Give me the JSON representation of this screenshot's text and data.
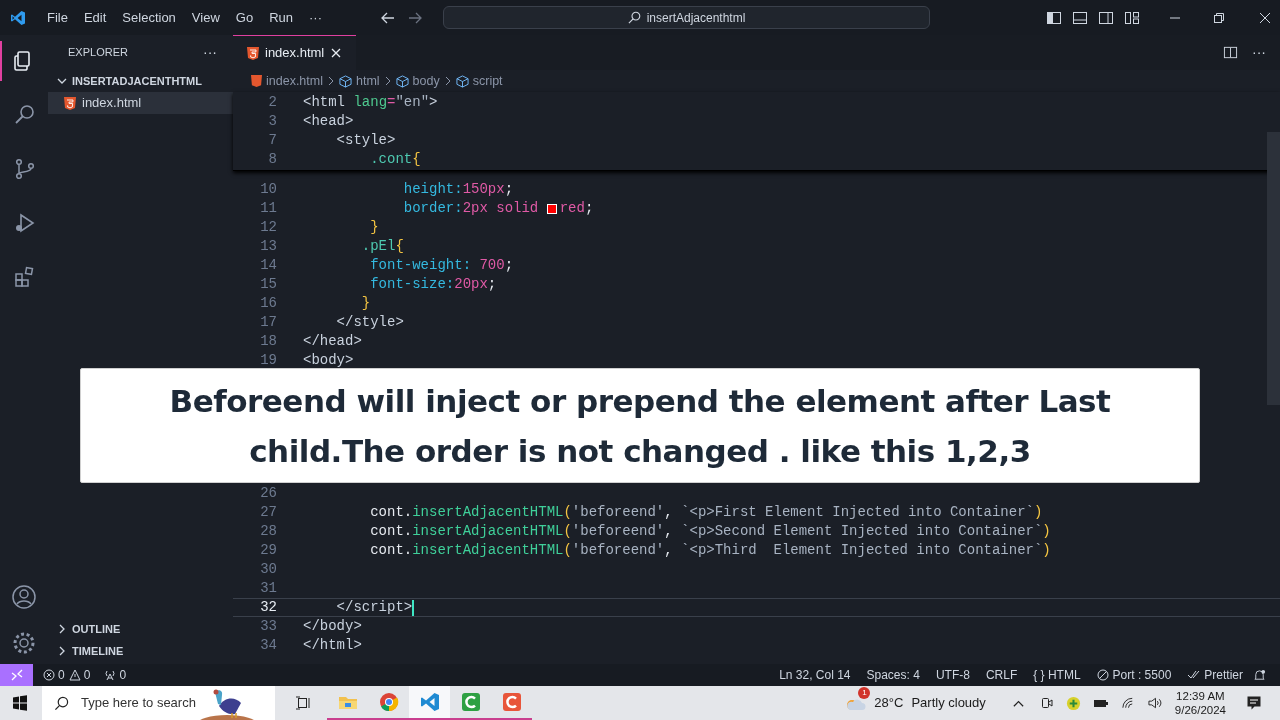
{
  "menu": [
    "File",
    "Edit",
    "Selection",
    "View",
    "Go",
    "Run",
    "···"
  ],
  "command_center": {
    "value": "insertAdjacenthtml"
  },
  "activity_bar": [
    {
      "kind": "files",
      "selected": true
    },
    {
      "kind": "search",
      "selected": false
    },
    {
      "kind": "source-control",
      "selected": false
    },
    {
      "kind": "run",
      "selected": false
    },
    {
      "kind": "extensions",
      "selected": false
    }
  ],
  "sidebar": {
    "title": "EXPLORER",
    "more": "···",
    "folder": {
      "name": "INSERTADJACENTHTML",
      "expanded": true,
      "files": [
        {
          "name": "index.html",
          "selected": true
        }
      ]
    },
    "sections": [
      {
        "name": "OUTLINE",
        "expanded": false
      },
      {
        "name": "TIMELINE",
        "expanded": false
      }
    ]
  },
  "tabs": [
    {
      "label": "index.html",
      "selected": true
    }
  ],
  "breadcrumb": [
    "index.html",
    "html",
    "body",
    "script"
  ],
  "sticky_lines": [
    {
      "n": "2",
      "tokens": [
        {
          "kind": "tag",
          "t": "<html "
        },
        {
          "kind": "attr",
          "t": "lang"
        },
        {
          "kind": "op",
          "t": "="
        },
        {
          "kind": "str",
          "t": "\"en\""
        },
        {
          "kind": "tag",
          "t": ">"
        }
      ]
    },
    {
      "n": "3",
      "tokens": [
        {
          "kind": "tag",
          "t": "<head>"
        }
      ]
    },
    {
      "n": "7",
      "tokens": [
        {
          "kind": "tag",
          "t": "    <style>"
        }
      ]
    },
    {
      "n": "8",
      "tokens": [
        {
          "kind": "sel",
          "t": "        .cont"
        },
        {
          "kind": "brace",
          "t": "{"
        }
      ]
    }
  ],
  "lines": [
    {
      "n": "10",
      "current": false,
      "tokens": [
        {
          "kind": "prop",
          "t": "            height:"
        },
        {
          "kind": "num",
          "t": "150"
        },
        {
          "kind": "num",
          "t": "px"
        },
        {
          "kind": "plain",
          "t": ";"
        }
      ]
    },
    {
      "n": "11",
      "current": false,
      "tokens": [
        {
          "kind": "prop",
          "t": "            border:"
        },
        {
          "kind": "num",
          "t": "2px solid "
        },
        {
          "kind": "swatch",
          "color": "#ff0000"
        },
        {
          "kind": "num",
          "t": "red"
        },
        {
          "kind": "plain",
          "t": ";"
        }
      ]
    },
    {
      "n": "12",
      "current": false,
      "tokens": [
        {
          "kind": "brace",
          "t": "        }"
        }
      ]
    },
    {
      "n": "13",
      "current": false,
      "tokens": [
        {
          "kind": "sel",
          "t": "       .pEl"
        },
        {
          "kind": "brace",
          "t": "{"
        }
      ]
    },
    {
      "n": "14",
      "current": false,
      "tokens": [
        {
          "kind": "prop",
          "t": "        font-weight: "
        },
        {
          "kind": "num",
          "t": "700"
        },
        {
          "kind": "plain",
          "t": ";"
        }
      ]
    },
    {
      "n": "15",
      "current": false,
      "tokens": [
        {
          "kind": "prop",
          "t": "        font-size:"
        },
        {
          "kind": "num",
          "t": "20"
        },
        {
          "kind": "num",
          "t": "px"
        },
        {
          "kind": "plain",
          "t": ";"
        }
      ]
    },
    {
      "n": "16",
      "current": false,
      "tokens": [
        {
          "kind": "brace",
          "t": "       }"
        }
      ]
    },
    {
      "n": "17",
      "current": false,
      "tokens": [
        {
          "kind": "tag",
          "t": "    </style>"
        }
      ]
    },
    {
      "n": "18",
      "current": false,
      "tokens": [
        {
          "kind": "tag",
          "t": "</head>"
        }
      ]
    },
    {
      "n": "19",
      "current": false,
      "tokens": [
        {
          "kind": "tag",
          "t": "<body>"
        }
      ]
    }
  ],
  "caption": "Beforeend will inject or prepend the element after Last child.The order is not changed . like this 1,2,3",
  "lines_below_caption": [
    {
      "n": "26",
      "current": false
    },
    {
      "n": "27",
      "current": false,
      "tokens": [
        {
          "kind": "plain",
          "t": "        cont."
        },
        {
          "kind": "fn",
          "t": "insertAdjacentHTML"
        },
        {
          "kind": "brace",
          "t": "("
        },
        {
          "kind": "str",
          "t": "'beforeend'"
        },
        {
          "kind": "plain",
          "t": ", "
        },
        {
          "kind": "str",
          "t": "`<p>First Element Injected into Container`"
        },
        {
          "kind": "brace",
          "t": ")"
        }
      ]
    },
    {
      "n": "28",
      "current": false,
      "tokens": [
        {
          "kind": "plain",
          "t": "        cont."
        },
        {
          "kind": "fn",
          "t": "insertAdjacentHTML"
        },
        {
          "kind": "brace",
          "t": "("
        },
        {
          "kind": "str",
          "t": "'beforeend'"
        },
        {
          "kind": "plain",
          "t": ", "
        },
        {
          "kind": "str",
          "t": "`<p>Second Element Injected into Container`"
        },
        {
          "kind": "brace",
          "t": ")"
        }
      ]
    },
    {
      "n": "29",
      "current": false,
      "tokens": [
        {
          "kind": "plain",
          "t": "        cont."
        },
        {
          "kind": "fn",
          "t": "insertAdjacentHTML"
        },
        {
          "kind": "brace",
          "t": "("
        },
        {
          "kind": "str",
          "t": "'beforeend'"
        },
        {
          "kind": "plain",
          "t": ", "
        },
        {
          "kind": "str",
          "t": "`<p>Third  Element Injected into Container`"
        },
        {
          "kind": "brace",
          "t": ")"
        }
      ]
    },
    {
      "n": "30",
      "current": false
    },
    {
      "n": "31",
      "current": false
    },
    {
      "n": "32",
      "current": true,
      "tokens": [
        {
          "kind": "tag",
          "t": "    </script>"
        }
      ]
    },
    {
      "n": "33",
      "current": false,
      "tokens": [
        {
          "kind": "tag",
          "t": "</body>"
        }
      ]
    },
    {
      "n": "34",
      "current": false,
      "tokens": [
        {
          "kind": "tag",
          "t": "</html>"
        }
      ]
    }
  ],
  "status_bar": {
    "errors": "0",
    "warnings": "0",
    "ports": "0",
    "items": [
      "Ln 32, Col 14",
      "Spaces: 4",
      "UTF-8",
      "CRLF",
      "{ } HTML",
      "Port : 5500",
      "Prettier"
    ]
  },
  "taskbar": {
    "search_placeholder": "Type here to search",
    "apps": [
      {
        "kind": "folder",
        "selected": false
      },
      {
        "kind": "chrome",
        "selected": false
      },
      {
        "kind": "vscode",
        "selected": true
      },
      {
        "kind": "camtasia-green",
        "selected": false
      },
      {
        "kind": "camtasia-red",
        "selected": false
      }
    ],
    "weather_badge": "1",
    "temperature": "28°C",
    "weather": "Partly cloudy",
    "time": "12:39 AM",
    "date": "9/26/2024"
  }
}
